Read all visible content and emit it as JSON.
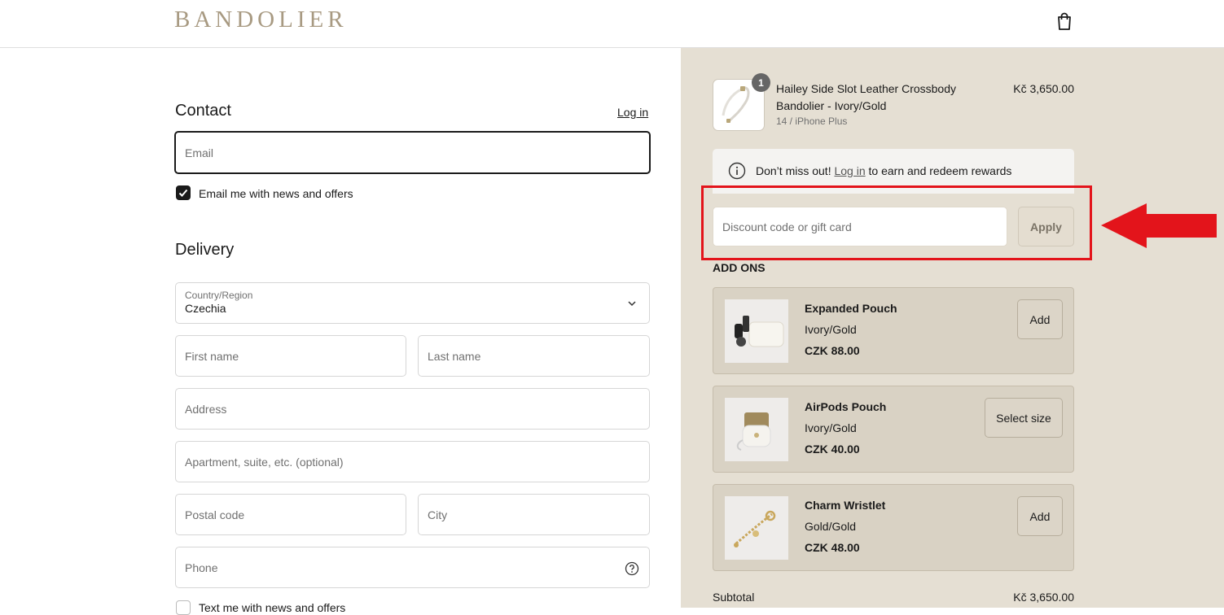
{
  "header": {
    "brand": "BANDOLIER",
    "bag_icon": "shopping-bag-icon"
  },
  "contact": {
    "title": "Contact",
    "login_link": "Log in",
    "email_placeholder": "Email",
    "newsletter_label": "Email me with news and offers",
    "newsletter_checked": true
  },
  "delivery": {
    "title": "Delivery",
    "country_label": "Country/Region",
    "country_value": "Czechia",
    "first_name_placeholder": "First name",
    "last_name_placeholder": "Last name",
    "address_placeholder": "Address",
    "apartment_placeholder": "Apartment, suite, etc. (optional)",
    "postal_placeholder": "Postal code",
    "city_placeholder": "City",
    "phone_placeholder": "Phone",
    "sms_label": "Text me with news and offers"
  },
  "order": {
    "product": {
      "name": "Hailey Side Slot Leather Crossbody Bandolier - Ivory/Gold",
      "variant": "14 / iPhone Plus",
      "price": "Kč 3,650.00",
      "quantity": "1"
    },
    "rewards": {
      "prefix": "Don’t miss out!",
      "link": "Log in",
      "suffix": "to earn and redeem rewards"
    },
    "discount_placeholder": "Discount code or gift card",
    "apply_label": "Apply",
    "addons_title": "ADD ONS",
    "addons": [
      {
        "name": "Expanded Pouch",
        "color": "Ivory/Gold",
        "price": "CZK 88.00",
        "button": "Add"
      },
      {
        "name": "AirPods Pouch",
        "color": "Ivory/Gold",
        "price": "CZK 40.00",
        "button": "Select size"
      },
      {
        "name": "Charm Wristlet",
        "color": "Gold/Gold",
        "price": "CZK 48.00",
        "button": "Add"
      }
    ],
    "subtotal_label": "Subtotal",
    "subtotal_value": "Kč 3,650.00"
  },
  "colors": {
    "accent": "#a89a82",
    "sidebar": "#e5dfd3",
    "highlight": "#e3141b"
  }
}
